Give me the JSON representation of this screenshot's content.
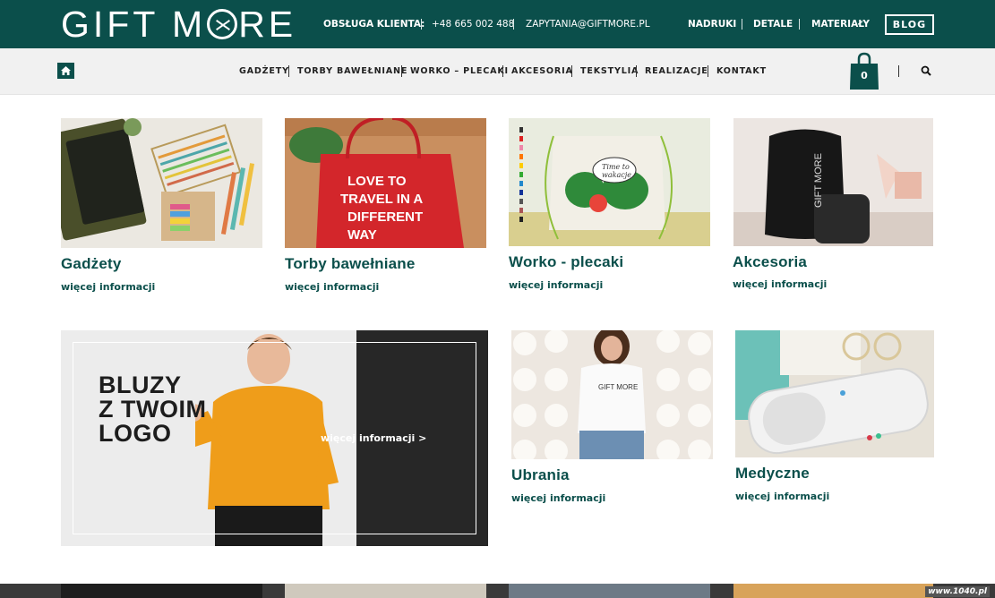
{
  "brand": {
    "logo_left": "GIFT M",
    "logo_right": "RE"
  },
  "top": {
    "contact_label": "OBSŁUGA KLIENTA:",
    "phone": "+48 665 002 488",
    "email": "ZAPYTANIA@GIFTMORE.PL",
    "links": [
      "NADRUKI",
      "DETALE",
      "MATERIAŁY"
    ],
    "blog": "BLOG"
  },
  "nav": {
    "items": [
      "GADŻETY",
      "TORBY BAWEŁNIANE",
      "WORKO – PLECAKI",
      "AKCESORIA",
      "TEKSTYLIA",
      "REALIZACJE",
      "KONTAKT"
    ],
    "cart_count": "0"
  },
  "categories": [
    {
      "title": "Gadżety",
      "link": "więcej informacji"
    },
    {
      "title": "Torby bawełniane",
      "link": "więcej informacji",
      "image_text": [
        "LOVE TO",
        "TRAVEL IN A",
        "DIFFERENT",
        "WAY"
      ]
    },
    {
      "title": "Worko - plecaki",
      "link": "więcej informacji",
      "image_text": [
        "Time to",
        "wakacje"
      ]
    },
    {
      "title": "Akcesoria",
      "link": "więcej informacji",
      "image_text": "GIFT MORE"
    },
    {
      "title": "Ubrania",
      "link": "więcej informacji",
      "image_text": "GIFT MORE"
    },
    {
      "title": "Medyczne",
      "link": "więcej informacji"
    }
  ],
  "banner": {
    "headline": [
      "BLUZY",
      "Z TWOIM",
      "LOGO"
    ],
    "link": "więcej informacji >"
  },
  "watermark": "www.1040.pl",
  "colors": {
    "brand": "#0b4f4b",
    "nav_bg": "#f1f1f1",
    "banner_dark": "#272727"
  }
}
